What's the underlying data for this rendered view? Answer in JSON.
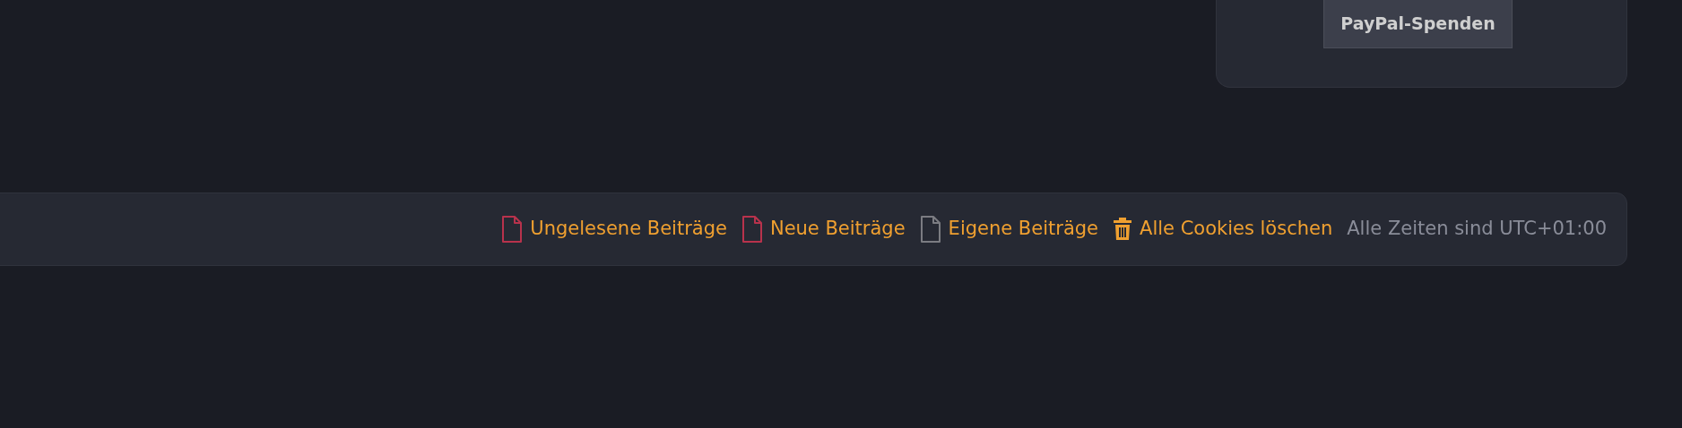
{
  "donate_card": {
    "button": "PayPal-Spenden"
  },
  "footer_links": [
    {
      "kind": "file",
      "color": "#b8324c",
      "label": "Ungelesene Beiträge"
    },
    {
      "kind": "file",
      "color": "#b8324c",
      "label": "Neue Beiträge"
    },
    {
      "kind": "file",
      "color": "#7b7c82",
      "label": "Eigene Beiträge"
    },
    {
      "kind": "trash",
      "color": "#f0a030",
      "label": "Alle Cookies löschen"
    }
  ],
  "timezone_note": "Alle Zeiten sind UTC+01:00"
}
